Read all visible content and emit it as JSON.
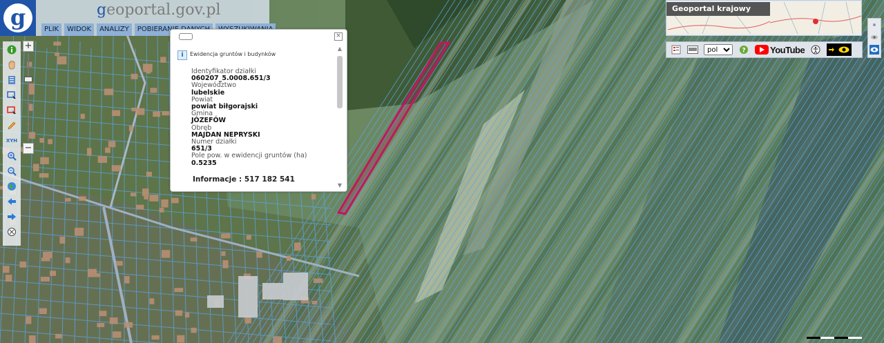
{
  "header": {
    "logo_letter": "g",
    "site_title_first": "g",
    "site_title_rest": "eoportal.gov.pl",
    "menu": [
      {
        "label": "PLIK"
      },
      {
        "label": "WIDOK"
      },
      {
        "label": "ANALIZY"
      },
      {
        "label": "POBIERANIE DANYCH"
      },
      {
        "label": "WYSZUKIWANIA"
      }
    ]
  },
  "toolbar": {
    "tools": [
      {
        "name": "info-icon"
      },
      {
        "name": "pan-hand-icon"
      },
      {
        "name": "layers-list-icon"
      },
      {
        "name": "select-area-icon"
      },
      {
        "name": "select-polygon-icon"
      },
      {
        "name": "draw-pencil-icon"
      },
      {
        "name": "xyz-coordinates-icon",
        "text": "XYH"
      },
      {
        "name": "zoom-in-magnifier-icon"
      },
      {
        "name": "zoom-out-magnifier-icon"
      },
      {
        "name": "globe-full-extent-icon"
      },
      {
        "name": "back-arrow-icon"
      },
      {
        "name": "forward-arrow-icon"
      },
      {
        "name": "clear-cross-icon"
      }
    ],
    "zoom_plus": "+",
    "zoom_minus": "−"
  },
  "popup": {
    "title": "Ewidencja gruntów i budynków",
    "close": "×",
    "fields": [
      {
        "label": "Identyfikator działki",
        "value": "060207_5.0008.651/3"
      },
      {
        "label": "Województwo",
        "value": "lubelskie"
      },
      {
        "label": "Powiat",
        "value": "powiat biłgorajski"
      },
      {
        "label": "Gmina",
        "value": "JÓZEFÓW"
      },
      {
        "label": "Obręb",
        "value": "MAJDAN NEPRYSKI"
      },
      {
        "label": "Numer działki",
        "value": "651/3"
      },
      {
        "label": "Pole pow. w ewidencji gruntów (ha)",
        "value": "0.5235"
      }
    ],
    "info_line": "Informacje : 517 182 541"
  },
  "overview": {
    "title": "Geoportal krajowy"
  },
  "right_toolbar": {
    "language": "pol",
    "language_options": [
      "pol"
    ],
    "youtube_label": "YouTube"
  },
  "colors": {
    "accent": "#1f54a8",
    "parcel_highlight": "#c0185e",
    "parcel_lines": "#5aa6e6"
  }
}
